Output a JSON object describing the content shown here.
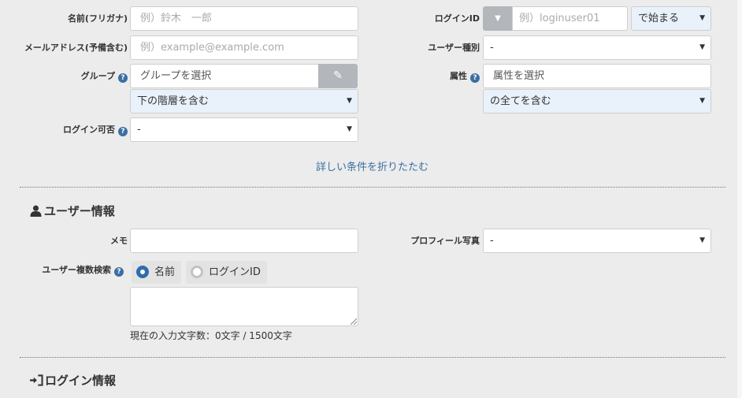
{
  "search": {
    "name_kana": {
      "label": "名前(フリガナ)",
      "placeholder": "例）鈴木　一郎"
    },
    "email": {
      "label": "メールアドレス(予備含む)",
      "placeholder": "例）example@example.com"
    },
    "group": {
      "label": "グループ",
      "placeholder": "グループを選択",
      "scope": "下の階層を含む"
    },
    "login_allowed": {
      "label": "ログイン可否",
      "value": "-"
    },
    "login_id": {
      "label": "ログインID",
      "placeholder": "例）loginuser01",
      "match": "で始まる"
    },
    "user_type": {
      "label": "ユーザー種別",
      "value": "-"
    },
    "attribute": {
      "label": "属性",
      "placeholder": "属性を選択",
      "scope": "の全てを含む"
    },
    "collapse_link": "詳しい条件を折りたたむ"
  },
  "user_info": {
    "title": "ユーザー情報",
    "memo_label": "メモ",
    "photo_label": "プロフィール写真",
    "photo_value": "-",
    "multi_search_label": "ユーザー複数検索",
    "radio_name": "名前",
    "radio_login": "ログインID",
    "counter": "現在の入力文字数：0文字 / 1500文字"
  },
  "login_info": {
    "title": "ログイン情報"
  },
  "icons": {
    "help": "?",
    "caret": "▼",
    "edit": "✎"
  }
}
